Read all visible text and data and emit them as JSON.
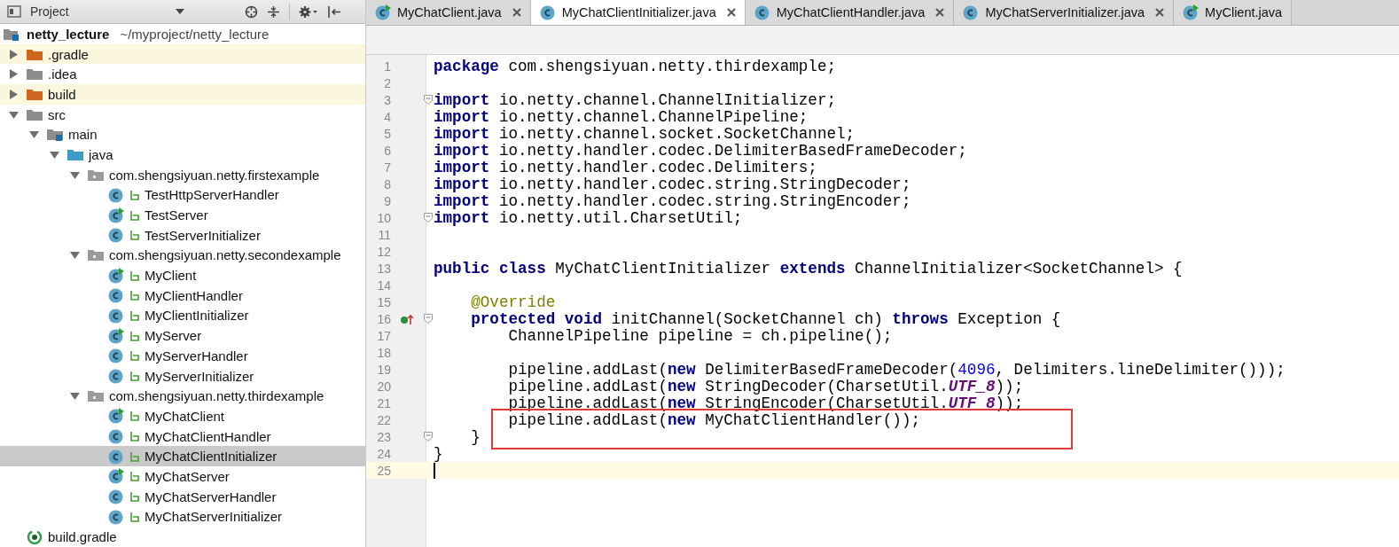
{
  "project_panel": {
    "title": "Project",
    "project": {
      "name": "netty_lecture",
      "path": "~/myproject/netty_lecture"
    },
    "tree": [
      {
        "label": ".gradle",
        "kind": "folder",
        "excluded": true,
        "expanded": false,
        "selected": false
      },
      {
        "label": ".idea",
        "kind": "folder",
        "excluded": false,
        "expanded": false,
        "selected": false
      },
      {
        "label": "build",
        "kind": "folder",
        "excluded": true,
        "expanded": false,
        "selected": false
      },
      {
        "label": "src",
        "kind": "folder",
        "excluded": false,
        "expanded": true,
        "selected": false,
        "children": [
          {
            "label": "main",
            "kind": "module-folder",
            "excluded": false,
            "expanded": true,
            "selected": false,
            "children": [
              {
                "label": "java",
                "kind": "source-folder",
                "excluded": false,
                "expanded": true,
                "selected": false,
                "children": [
                  {
                    "label": "com.shengsiyuan.netty.firstexample",
                    "kind": "package",
                    "excluded": false,
                    "expanded": true,
                    "selected": false,
                    "children": [
                      {
                        "label": "TestHttpServerHandler",
                        "kind": "class",
                        "runnable": false,
                        "selected": false
                      },
                      {
                        "label": "TestServer",
                        "kind": "class",
                        "runnable": true,
                        "selected": false
                      },
                      {
                        "label": "TestServerInitializer",
                        "kind": "class",
                        "runnable": false,
                        "selected": false
                      }
                    ]
                  },
                  {
                    "label": "com.shengsiyuan.netty.secondexample",
                    "kind": "package",
                    "excluded": false,
                    "expanded": true,
                    "selected": false,
                    "children": [
                      {
                        "label": "MyClient",
                        "kind": "class",
                        "runnable": true,
                        "selected": false
                      },
                      {
                        "label": "MyClientHandler",
                        "kind": "class",
                        "runnable": false,
                        "selected": false
                      },
                      {
                        "label": "MyClientInitializer",
                        "kind": "class",
                        "runnable": false,
                        "selected": false
                      },
                      {
                        "label": "MyServer",
                        "kind": "class",
                        "runnable": true,
                        "selected": false
                      },
                      {
                        "label": "MyServerHandler",
                        "kind": "class",
                        "runnable": false,
                        "selected": false
                      },
                      {
                        "label": "MyServerInitializer",
                        "kind": "class",
                        "runnable": false,
                        "selected": false
                      }
                    ]
                  },
                  {
                    "label": "com.shengsiyuan.netty.thirdexample",
                    "kind": "package",
                    "excluded": false,
                    "expanded": true,
                    "selected": false,
                    "children": [
                      {
                        "label": "MyChatClient",
                        "kind": "class",
                        "runnable": true,
                        "selected": false
                      },
                      {
                        "label": "MyChatClientHandler",
                        "kind": "class",
                        "runnable": false,
                        "selected": false
                      },
                      {
                        "label": "MyChatClientInitializer",
                        "kind": "class",
                        "runnable": false,
                        "selected": true
                      },
                      {
                        "label": "MyChatServer",
                        "kind": "class",
                        "runnable": true,
                        "selected": false
                      },
                      {
                        "label": "MyChatServerHandler",
                        "kind": "class",
                        "runnable": false,
                        "selected": false
                      },
                      {
                        "label": "MyChatServerInitializer",
                        "kind": "class",
                        "runnable": false,
                        "selected": false
                      }
                    ]
                  }
                ]
              }
            ]
          }
        ]
      },
      {
        "label": "build.gradle",
        "kind": "gradle",
        "selected": false
      }
    ]
  },
  "editor_tabs": [
    {
      "label": "MyChatClient.java",
      "runnable": true,
      "selected": false,
      "closable": true
    },
    {
      "label": "MyChatClientInitializer.java",
      "runnable": false,
      "selected": true,
      "closable": true
    },
    {
      "label": "MyChatClientHandler.java",
      "runnable": false,
      "selected": false,
      "closable": true
    },
    {
      "label": "MyChatServerInitializer.java",
      "runnable": false,
      "selected": false,
      "closable": true
    },
    {
      "label": "MyClient.java",
      "runnable": true,
      "selected": false,
      "closable": false
    }
  ],
  "code": {
    "lines": [
      {
        "number": "1",
        "fold": false,
        "override": false,
        "current": false,
        "boxed": false,
        "tokens": [
          {
            "kind": "kw",
            "text": "package"
          },
          {
            "kind": "plain",
            "text": " com.shengsiyuan.netty.thirdexample;"
          }
        ]
      },
      {
        "number": "2",
        "fold": false,
        "override": false,
        "current": false,
        "boxed": false
      },
      {
        "number": "3",
        "fold": true,
        "override": false,
        "current": false,
        "boxed": false,
        "tokens": [
          {
            "kind": "kw",
            "text": "import"
          },
          {
            "kind": "plain",
            "text": " io.netty.channel.ChannelInitializer;"
          }
        ]
      },
      {
        "number": "4",
        "fold": false,
        "override": false,
        "current": false,
        "boxed": false,
        "tokens": [
          {
            "kind": "kw",
            "text": "import"
          },
          {
            "kind": "plain",
            "text": " io.netty.channel.ChannelPipeline;"
          }
        ]
      },
      {
        "number": "5",
        "fold": false,
        "override": false,
        "current": false,
        "boxed": false,
        "tokens": [
          {
            "kind": "kw",
            "text": "import"
          },
          {
            "kind": "plain",
            "text": " io.netty.channel.socket.SocketChannel;"
          }
        ]
      },
      {
        "number": "6",
        "fold": false,
        "override": false,
        "current": false,
        "boxed": false,
        "tokens": [
          {
            "kind": "kw",
            "text": "import"
          },
          {
            "kind": "plain",
            "text": " io.netty.handler.codec.DelimiterBasedFrameDecoder;"
          }
        ]
      },
      {
        "number": "7",
        "fold": false,
        "override": false,
        "current": false,
        "boxed": false,
        "tokens": [
          {
            "kind": "kw",
            "text": "import"
          },
          {
            "kind": "plain",
            "text": " io.netty.handler.codec.Delimiters;"
          }
        ]
      },
      {
        "number": "8",
        "fold": false,
        "override": false,
        "current": false,
        "boxed": false,
        "tokens": [
          {
            "kind": "kw",
            "text": "import"
          },
          {
            "kind": "plain",
            "text": " io.netty.handler.codec.string.StringDecoder;"
          }
        ]
      },
      {
        "number": "9",
        "fold": false,
        "override": false,
        "current": false,
        "boxed": false,
        "tokens": [
          {
            "kind": "kw",
            "text": "import"
          },
          {
            "kind": "plain",
            "text": " io.netty.handler.codec.string.StringEncoder;"
          }
        ]
      },
      {
        "number": "10",
        "fold": true,
        "override": false,
        "current": false,
        "boxed": false,
        "tokens": [
          {
            "kind": "kw",
            "text": "import"
          },
          {
            "kind": "plain",
            "text": " io.netty.util.CharsetUtil;"
          }
        ]
      },
      {
        "number": "11",
        "fold": false,
        "override": false,
        "current": false,
        "boxed": false
      },
      {
        "number": "12",
        "fold": false,
        "override": false,
        "current": false,
        "boxed": false
      },
      {
        "number": "13",
        "fold": false,
        "override": false,
        "current": false,
        "boxed": false,
        "tokens": [
          {
            "kind": "kw",
            "text": "public class"
          },
          {
            "kind": "plain",
            "text": " MyChatClientInitializer "
          },
          {
            "kind": "kw",
            "text": "extends"
          },
          {
            "kind": "plain",
            "text": " ChannelInitializer<SocketChannel> {"
          }
        ]
      },
      {
        "number": "14",
        "fold": false,
        "override": false,
        "current": false,
        "boxed": false
      },
      {
        "number": "15",
        "fold": false,
        "override": false,
        "current": false,
        "boxed": false,
        "tokens": [
          {
            "kind": "annotation",
            "text": "    @Override"
          }
        ]
      },
      {
        "number": "16",
        "fold": true,
        "override": true,
        "current": false,
        "boxed": false,
        "tokens": [
          {
            "kind": "kw",
            "text": "    protected void"
          },
          {
            "kind": "plain",
            "text": " initChannel(SocketChannel ch) "
          },
          {
            "kind": "kw",
            "text": "throws"
          },
          {
            "kind": "plain",
            "text": " Exception {"
          }
        ]
      },
      {
        "number": "17",
        "fold": false,
        "override": false,
        "current": false,
        "boxed": false,
        "tokens": [
          {
            "kind": "plain",
            "text": "        ChannelPipeline pipeline = ch.pipeline();"
          }
        ]
      },
      {
        "number": "18",
        "fold": false,
        "override": false,
        "current": false,
        "boxed": false
      },
      {
        "number": "19",
        "fold": false,
        "override": false,
        "current": false,
        "boxed": false,
        "tokens": [
          {
            "kind": "plain",
            "text": "        pipeline.addLast("
          },
          {
            "kind": "kw",
            "text": "new"
          },
          {
            "kind": "plain",
            "text": " DelimiterBasedFrameDecoder("
          },
          {
            "kind": "number",
            "text": "4096"
          },
          {
            "kind": "plain",
            "text": ", Delimiters.lineDelimiter()));"
          }
        ]
      },
      {
        "number": "20",
        "fold": false,
        "override": false,
        "current": false,
        "boxed": false,
        "tokens": [
          {
            "kind": "plain",
            "text": "        pipeline.addLast("
          },
          {
            "kind": "kw",
            "text": "new"
          },
          {
            "kind": "plain",
            "text": " StringDecoder(CharsetUtil."
          },
          {
            "kind": "static",
            "text": "UTF_8"
          },
          {
            "kind": "plain",
            "text": "));"
          }
        ]
      },
      {
        "number": "21",
        "fold": false,
        "override": false,
        "current": false,
        "boxed": false,
        "tokens": [
          {
            "kind": "plain",
            "text": "        pipeline.addLast("
          },
          {
            "kind": "kw",
            "text": "new"
          },
          {
            "kind": "plain",
            "text": " StringEncoder(CharsetUtil."
          },
          {
            "kind": "static",
            "text": "UTF_8"
          },
          {
            "kind": "plain",
            "text": "));"
          }
        ]
      },
      {
        "number": "22",
        "fold": false,
        "override": false,
        "current": false,
        "boxed": true,
        "tokens": [
          {
            "kind": "plain",
            "text": "        pipeline.addLast("
          },
          {
            "kind": "kw",
            "text": "new"
          },
          {
            "kind": "plain",
            "text": " MyChatClientHandler());"
          }
        ]
      },
      {
        "number": "23",
        "fold": true,
        "override": false,
        "current": false,
        "boxed": true,
        "tokens": [
          {
            "kind": "plain",
            "text": "    }"
          }
        ]
      },
      {
        "number": "24",
        "fold": false,
        "override": false,
        "current": false,
        "boxed": false,
        "tokens": [
          {
            "kind": "plain",
            "text": "}"
          }
        ]
      },
      {
        "number": "25",
        "fold": false,
        "override": false,
        "current": true,
        "boxed": false
      }
    ]
  }
}
